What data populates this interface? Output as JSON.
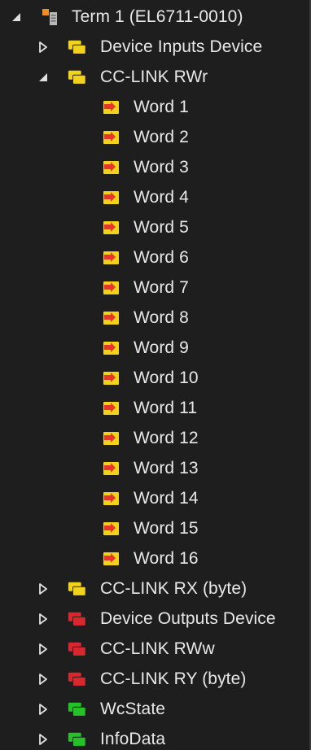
{
  "tree": {
    "root": {
      "label": "Term 1 (EL6711-0010)",
      "toggle": "expanded",
      "icon": "terminal-icon"
    },
    "items": [
      {
        "label": "Device Inputs Device",
        "toggle": "collapsed",
        "icon": "input-folder-icon",
        "color": "#f3d21b"
      },
      {
        "label": "CC-LINK RWr",
        "toggle": "expanded",
        "icon": "input-folder-icon",
        "color": "#f3d21b",
        "children": [
          {
            "label": "Word 1"
          },
          {
            "label": "Word 2"
          },
          {
            "label": "Word 3"
          },
          {
            "label": "Word 4"
          },
          {
            "label": "Word 5"
          },
          {
            "label": "Word 6"
          },
          {
            "label": "Word 7"
          },
          {
            "label": "Word 8"
          },
          {
            "label": "Word 9"
          },
          {
            "label": "Word 10"
          },
          {
            "label": "Word 11"
          },
          {
            "label": "Word 12"
          },
          {
            "label": "Word 13"
          },
          {
            "label": "Word 14"
          },
          {
            "label": "Word 15"
          },
          {
            "label": "Word 16"
          }
        ]
      },
      {
        "label": "CC-LINK RX (byte)",
        "toggle": "collapsed",
        "icon": "input-folder-icon",
        "color": "#f3d21b"
      },
      {
        "label": "Device Outputs Device",
        "toggle": "collapsed",
        "icon": "output-folder-icon",
        "color": "#d8282e"
      },
      {
        "label": "CC-LINK RWw",
        "toggle": "collapsed",
        "icon": "output-folder-icon",
        "color": "#d8282e"
      },
      {
        "label": "CC-LINK RY (byte)",
        "toggle": "collapsed",
        "icon": "output-folder-icon",
        "color": "#d8282e"
      },
      {
        "label": "WcState",
        "toggle": "collapsed",
        "icon": "status-folder-icon",
        "color": "#25c227"
      },
      {
        "label": "InfoData",
        "toggle": "collapsed",
        "icon": "status-folder-icon",
        "color": "#25c227"
      }
    ]
  },
  "colors": {
    "background": "#1e1e1e",
    "text": "#e8e8e8",
    "toggle": "#e0e0e0",
    "input": "#f3d21b",
    "output": "#d8282e",
    "status": "#25c227",
    "variable_arrow": "#e8352c"
  }
}
